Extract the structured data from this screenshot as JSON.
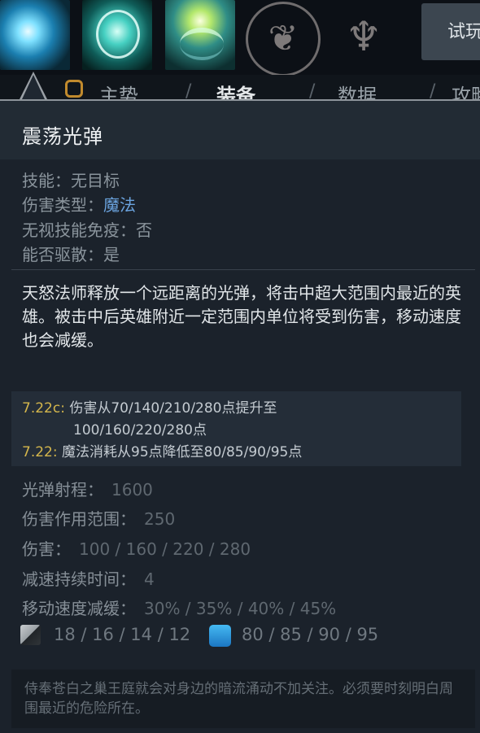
{
  "tabs": {
    "t1": "主势",
    "t2": "装备",
    "t3": "数据",
    "t4": "攻略"
  },
  "trial_button": "试玩",
  "ability": {
    "title": "震荡光弹",
    "info": [
      {
        "label": "技能：",
        "value": "无目标"
      },
      {
        "label": "伤害类型：",
        "value": "魔法"
      },
      {
        "label": "无视技能免疫：",
        "value": "否"
      },
      {
        "label": "能否驱散：",
        "value": "是"
      }
    ],
    "description": "天怒法师释放一个远距离的光弹，将击中超大范围内最近的英雄。被击中后英雄附近一定范围内单位将受到伤害，移动速度也会减缓。",
    "patch_notes": [
      {
        "version": "7.22c:",
        "text": "伤害从70/140/210/280点提升至"
      },
      {
        "version": "",
        "text": "100/160/220/280点"
      },
      {
        "version": "7.22:",
        "text": "魔法消耗从95点降低至80/85/90/95点"
      }
    ],
    "stats": [
      {
        "label": "光弹射程：",
        "value": "1600"
      },
      {
        "label": "伤害作用范围：",
        "value": "250"
      },
      {
        "label": "伤害：",
        "value": "100 / 160 / 220 / 280"
      },
      {
        "label": "减速持续时间：",
        "value": "4"
      },
      {
        "label": "移动速度减缓：",
        "value": "30% / 35% / 40% / 45%"
      }
    ],
    "cooldown": "18 / 16 / 14 / 12",
    "mana_cost": "80 / 85 / 90 / 95",
    "lore": "侍奉苍白之巢王庭就会对身边的暗流涌动不加关注。必须要时刻明白周围最近的危险所在。"
  },
  "colors": {
    "accent_blue": "#6ba4df",
    "patch_version": "#d4b64c",
    "mana": "#2c96dc"
  },
  "icons": {
    "cooldown": "cooldown-icon",
    "mana": "mana-icon"
  }
}
